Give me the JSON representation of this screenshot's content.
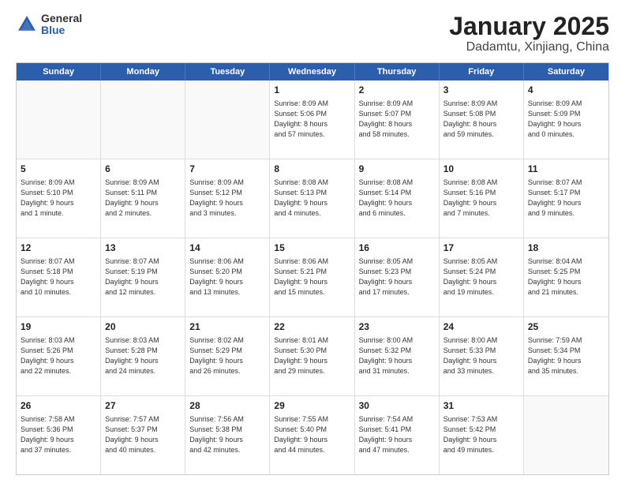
{
  "logo": {
    "general": "General",
    "blue": "Blue"
  },
  "title": "January 2025",
  "subtitle": "Dadamtu, Xinjiang, China",
  "header_days": [
    "Sunday",
    "Monday",
    "Tuesday",
    "Wednesday",
    "Thursday",
    "Friday",
    "Saturday"
  ],
  "weeks": [
    [
      {
        "day": "",
        "lines": [],
        "empty": true
      },
      {
        "day": "",
        "lines": [],
        "empty": true
      },
      {
        "day": "",
        "lines": [],
        "empty": true
      },
      {
        "day": "1",
        "lines": [
          "Sunrise: 8:09 AM",
          "Sunset: 5:06 PM",
          "Daylight: 8 hours",
          "and 57 minutes."
        ],
        "empty": false
      },
      {
        "day": "2",
        "lines": [
          "Sunrise: 8:09 AM",
          "Sunset: 5:07 PM",
          "Daylight: 8 hours",
          "and 58 minutes."
        ],
        "empty": false
      },
      {
        "day": "3",
        "lines": [
          "Sunrise: 8:09 AM",
          "Sunset: 5:08 PM",
          "Daylight: 8 hours",
          "and 59 minutes."
        ],
        "empty": false
      },
      {
        "day": "4",
        "lines": [
          "Sunrise: 8:09 AM",
          "Sunset: 5:09 PM",
          "Daylight: 9 hours",
          "and 0 minutes."
        ],
        "empty": false
      }
    ],
    [
      {
        "day": "5",
        "lines": [
          "Sunrise: 8:09 AM",
          "Sunset: 5:10 PM",
          "Daylight: 9 hours",
          "and 1 minute."
        ],
        "empty": false
      },
      {
        "day": "6",
        "lines": [
          "Sunrise: 8:09 AM",
          "Sunset: 5:11 PM",
          "Daylight: 9 hours",
          "and 2 minutes."
        ],
        "empty": false
      },
      {
        "day": "7",
        "lines": [
          "Sunrise: 8:09 AM",
          "Sunset: 5:12 PM",
          "Daylight: 9 hours",
          "and 3 minutes."
        ],
        "empty": false
      },
      {
        "day": "8",
        "lines": [
          "Sunrise: 8:08 AM",
          "Sunset: 5:13 PM",
          "Daylight: 9 hours",
          "and 4 minutes."
        ],
        "empty": false
      },
      {
        "day": "9",
        "lines": [
          "Sunrise: 8:08 AM",
          "Sunset: 5:14 PM",
          "Daylight: 9 hours",
          "and 6 minutes."
        ],
        "empty": false
      },
      {
        "day": "10",
        "lines": [
          "Sunrise: 8:08 AM",
          "Sunset: 5:16 PM",
          "Daylight: 9 hours",
          "and 7 minutes."
        ],
        "empty": false
      },
      {
        "day": "11",
        "lines": [
          "Sunrise: 8:07 AM",
          "Sunset: 5:17 PM",
          "Daylight: 9 hours",
          "and 9 minutes."
        ],
        "empty": false
      }
    ],
    [
      {
        "day": "12",
        "lines": [
          "Sunrise: 8:07 AM",
          "Sunset: 5:18 PM",
          "Daylight: 9 hours",
          "and 10 minutes."
        ],
        "empty": false
      },
      {
        "day": "13",
        "lines": [
          "Sunrise: 8:07 AM",
          "Sunset: 5:19 PM",
          "Daylight: 9 hours",
          "and 12 minutes."
        ],
        "empty": false
      },
      {
        "day": "14",
        "lines": [
          "Sunrise: 8:06 AM",
          "Sunset: 5:20 PM",
          "Daylight: 9 hours",
          "and 13 minutes."
        ],
        "empty": false
      },
      {
        "day": "15",
        "lines": [
          "Sunrise: 8:06 AM",
          "Sunset: 5:21 PM",
          "Daylight: 9 hours",
          "and 15 minutes."
        ],
        "empty": false
      },
      {
        "day": "16",
        "lines": [
          "Sunrise: 8:05 AM",
          "Sunset: 5:23 PM",
          "Daylight: 9 hours",
          "and 17 minutes."
        ],
        "empty": false
      },
      {
        "day": "17",
        "lines": [
          "Sunrise: 8:05 AM",
          "Sunset: 5:24 PM",
          "Daylight: 9 hours",
          "and 19 minutes."
        ],
        "empty": false
      },
      {
        "day": "18",
        "lines": [
          "Sunrise: 8:04 AM",
          "Sunset: 5:25 PM",
          "Daylight: 9 hours",
          "and 21 minutes."
        ],
        "empty": false
      }
    ],
    [
      {
        "day": "19",
        "lines": [
          "Sunrise: 8:03 AM",
          "Sunset: 5:26 PM",
          "Daylight: 9 hours",
          "and 22 minutes."
        ],
        "empty": false
      },
      {
        "day": "20",
        "lines": [
          "Sunrise: 8:03 AM",
          "Sunset: 5:28 PM",
          "Daylight: 9 hours",
          "and 24 minutes."
        ],
        "empty": false
      },
      {
        "day": "21",
        "lines": [
          "Sunrise: 8:02 AM",
          "Sunset: 5:29 PM",
          "Daylight: 9 hours",
          "and 26 minutes."
        ],
        "empty": false
      },
      {
        "day": "22",
        "lines": [
          "Sunrise: 8:01 AM",
          "Sunset: 5:30 PM",
          "Daylight: 9 hours",
          "and 29 minutes."
        ],
        "empty": false
      },
      {
        "day": "23",
        "lines": [
          "Sunrise: 8:00 AM",
          "Sunset: 5:32 PM",
          "Daylight: 9 hours",
          "and 31 minutes."
        ],
        "empty": false
      },
      {
        "day": "24",
        "lines": [
          "Sunrise: 8:00 AM",
          "Sunset: 5:33 PM",
          "Daylight: 9 hours",
          "and 33 minutes."
        ],
        "empty": false
      },
      {
        "day": "25",
        "lines": [
          "Sunrise: 7:59 AM",
          "Sunset: 5:34 PM",
          "Daylight: 9 hours",
          "and 35 minutes."
        ],
        "empty": false
      }
    ],
    [
      {
        "day": "26",
        "lines": [
          "Sunrise: 7:58 AM",
          "Sunset: 5:36 PM",
          "Daylight: 9 hours",
          "and 37 minutes."
        ],
        "empty": false
      },
      {
        "day": "27",
        "lines": [
          "Sunrise: 7:57 AM",
          "Sunset: 5:37 PM",
          "Daylight: 9 hours",
          "and 40 minutes."
        ],
        "empty": false
      },
      {
        "day": "28",
        "lines": [
          "Sunrise: 7:56 AM",
          "Sunset: 5:38 PM",
          "Daylight: 9 hours",
          "and 42 minutes."
        ],
        "empty": false
      },
      {
        "day": "29",
        "lines": [
          "Sunrise: 7:55 AM",
          "Sunset: 5:40 PM",
          "Daylight: 9 hours",
          "and 44 minutes."
        ],
        "empty": false
      },
      {
        "day": "30",
        "lines": [
          "Sunrise: 7:54 AM",
          "Sunset: 5:41 PM",
          "Daylight: 9 hours",
          "and 47 minutes."
        ],
        "empty": false
      },
      {
        "day": "31",
        "lines": [
          "Sunrise: 7:53 AM",
          "Sunset: 5:42 PM",
          "Daylight: 9 hours",
          "and 49 minutes."
        ],
        "empty": false
      },
      {
        "day": "",
        "lines": [],
        "empty": true
      }
    ]
  ]
}
